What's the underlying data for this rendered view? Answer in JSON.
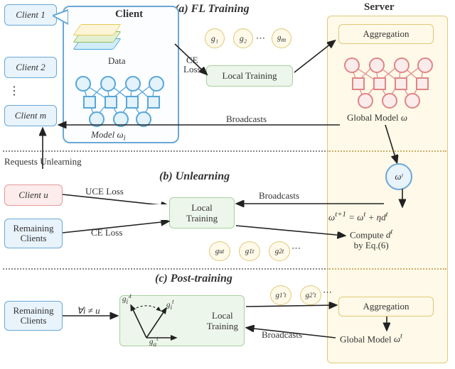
{
  "clients": {
    "c1": "Client 1",
    "c2": "Client 2",
    "cm": "Client m",
    "bubble_title": "Client",
    "data_label": "Data",
    "model_label": "Model ω_i"
  },
  "server_header": "Server",
  "sectionA": {
    "title": "(a) FL Training",
    "ce_loss": "CE\nLoss",
    "local_train": "Local Training",
    "bc": "Broadcasts",
    "g1": "g₁",
    "g2": "g₂",
    "gm": "g_m",
    "aggregation": "Aggregation",
    "global_model": "Global Model ω"
  },
  "sectionB": {
    "title": "(b) Unlearning",
    "req": "Requests Unlearning",
    "client_u": "Client u",
    "remain": "Remaining\nClients",
    "uce": "UCE Loss",
    "ce": "CE Loss",
    "local_train": "Local\nTraining",
    "bc": "Broadcasts",
    "wt": "ωᵗ",
    "update": "ωᵗ⁺¹ = ωᵗ + ηdᵗ",
    "compute": "Compute dᵗ\nby Eq.(6)",
    "gu": "g_uᵗ",
    "g1t": "g₁ᵗ",
    "g2t": "g₂ᵗ"
  },
  "sectionC": {
    "title": "(c) Post-training",
    "remain": "Remaining\nClients",
    "cond": "∀i ≠ u",
    "local_train": "Local\nTraining",
    "bc": "Broadcasts",
    "g1p": "g₁'ᵗ",
    "g2p": "g₂'ᵗ",
    "g_left": "g_i'ᵗ",
    "g_right": "g_iᵗ",
    "g_bottom": "g_aᵗ",
    "aggregation": "Aggregation",
    "global_model": "Global Model ωᵗ"
  }
}
